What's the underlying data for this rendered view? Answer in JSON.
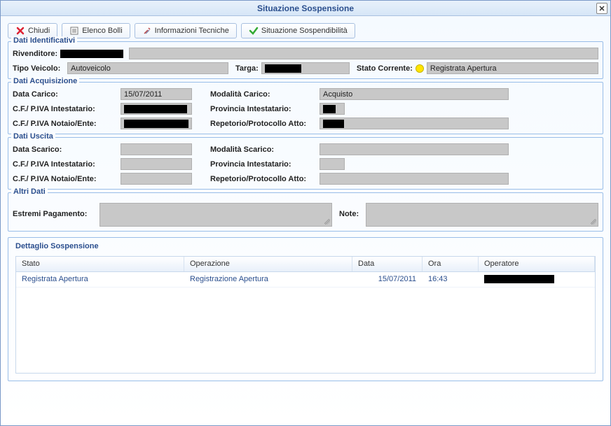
{
  "window": {
    "title": "Situazione Sospensione"
  },
  "toolbar": {
    "close": "Chiudi",
    "elenco": "Elenco Bolli",
    "tech": "Informazioni Tecniche",
    "sosp": "Situazione Sospendibilità"
  },
  "sections": {
    "ident": {
      "legend": "Dati Identificativi",
      "rivenditore_label": "Rivenditore:",
      "rivenditore": "",
      "tipo_label": "Tipo Veicolo:",
      "tipo": "Autoveicolo",
      "targa_label": "Targa:",
      "targa": "",
      "stato_label": "Stato Corrente:",
      "stato": "Registrata Apertura"
    },
    "acq": {
      "legend": "Dati Acquisizione",
      "data_label": "Data Carico:",
      "data": "15/07/2011",
      "mod_label": "Modalità Carico:",
      "mod": "Acquisto",
      "cfint_label": "C.F./ P.IVA Intestatario:",
      "cfint": "",
      "prov_label": "Provincia Intestatario:",
      "prov": "",
      "cfnot_label": "C.F./ P.IVA Notaio/Ente:",
      "cfnot": "",
      "rep_label": "Repetorio/Protocollo Atto:",
      "rep": ""
    },
    "usc": {
      "legend": "Dati Uscita",
      "data_label": "Data Scarico:",
      "data": "",
      "mod_label": "Modalità Scarico:",
      "mod": "",
      "cfint_label": "C.F./ P.IVA Intestatario:",
      "cfint": "",
      "prov_label": "Provincia Intestatario:",
      "prov": "",
      "cfnot_label": "C.F./ P.IVA Notaio/Ente:",
      "cfnot": "",
      "rep_label": "Repetorio/Protocollo Atto:",
      "rep": ""
    },
    "altri": {
      "legend": "Altri Dati",
      "estremi_label": "Estremi Pagamento:",
      "note_label": "Note:"
    }
  },
  "detail": {
    "title": "Dettaglio Sospensione",
    "headers": {
      "stato": "Stato",
      "oper": "Operazione",
      "data": "Data",
      "ora": "Ora",
      "user": "Operatore"
    },
    "rows": [
      {
        "stato": "Registrata Apertura",
        "oper": "Registrazione Apertura",
        "data": "15/07/2011",
        "ora": "16:43",
        "user": ""
      }
    ]
  }
}
